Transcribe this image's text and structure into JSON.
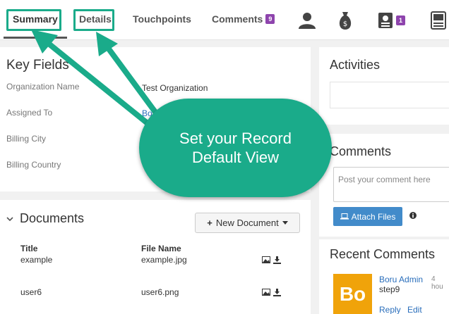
{
  "tabs": {
    "summary": "Summary",
    "details": "Details",
    "touchpoints": "Touchpoints",
    "comments": "Comments",
    "comments_count": "9",
    "id_count": "1"
  },
  "key_fields": {
    "title": "Key Fields",
    "rows": [
      {
        "label": "Organization Name",
        "value": "Test Organization"
      },
      {
        "label": "Assigned To",
        "value": "Bo"
      },
      {
        "label": "Billing City",
        "value": ""
      },
      {
        "label": "Billing Country",
        "value": ""
      }
    ]
  },
  "documents": {
    "title": "Documents",
    "new_button": "New Document",
    "col_title": "Title",
    "col_filename": "File Name",
    "rows": [
      {
        "title": "example",
        "file": "example.jpg"
      },
      {
        "title": "user6",
        "file": "user6.png"
      }
    ]
  },
  "activities": {
    "title": "Activities"
  },
  "comments_panel": {
    "title": "Comments",
    "placeholder": "Post your comment here",
    "attach_label": "Attach Files"
  },
  "recent_comments": {
    "title": "Recent Comments",
    "avatar_initials": "Bo",
    "author": "Boru Admin",
    "time": "4 hou",
    "text": "step9",
    "reply": "Reply",
    "edit": "Edit"
  },
  "callout": {
    "line1": "Set your Record",
    "line2": "Default View"
  },
  "colors": {
    "accent": "#1aab8a",
    "badge": "#8e44ad",
    "button": "#428bca",
    "avatar": "#f0a30a"
  }
}
